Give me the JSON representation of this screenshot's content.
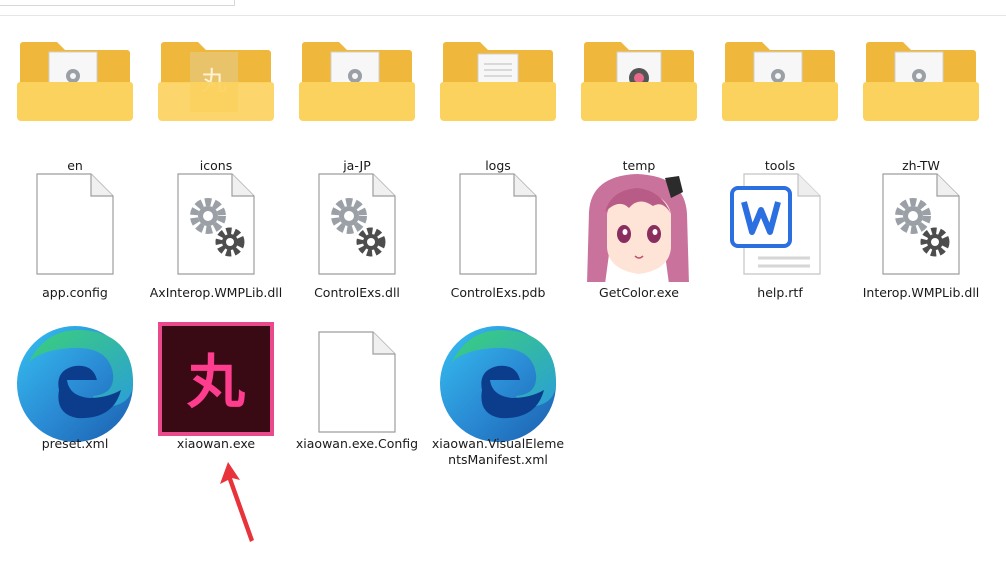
{
  "items": [
    {
      "name": "en",
      "type": "folder",
      "icon": "folder-config-icon"
    },
    {
      "name": "icons",
      "type": "folder",
      "icon": "folder-icons-icon"
    },
    {
      "name": "ja-JP",
      "type": "folder",
      "icon": "folder-config-icon"
    },
    {
      "name": "logs",
      "type": "folder",
      "icon": "folder-document-icon"
    },
    {
      "name": "temp",
      "type": "folder",
      "icon": "folder-media-icon"
    },
    {
      "name": "tools",
      "type": "folder",
      "icon": "folder-config-icon"
    },
    {
      "name": "zh-TW",
      "type": "folder",
      "icon": "folder-config-icon"
    },
    {
      "name": "app.config",
      "type": "file",
      "icon": "blank-file-icon"
    },
    {
      "name": "AxInterop.WMPLib.dll",
      "type": "file",
      "icon": "dll-gears-icon"
    },
    {
      "name": "ControlExs.dll",
      "type": "file",
      "icon": "dll-gears-icon"
    },
    {
      "name": "ControlExs.pdb",
      "type": "file",
      "icon": "blank-file-icon"
    },
    {
      "name": "GetColor.exe",
      "type": "file",
      "icon": "anime-girl-app-icon"
    },
    {
      "name": "help.rtf",
      "type": "file",
      "icon": "wps-writer-icon"
    },
    {
      "name": "Interop.WMPLib.dll",
      "type": "file",
      "icon": "dll-gears-icon"
    },
    {
      "name": "preset.xml",
      "type": "file",
      "icon": "edge-browser-icon"
    },
    {
      "name": "xiaowan.exe",
      "type": "file",
      "icon": "xiaowan-app-icon",
      "selected": true,
      "glyph": "丸"
    },
    {
      "name": "xiaowan.exe.Config",
      "type": "file",
      "icon": "blank-file-icon"
    },
    {
      "name": "xiaowan.VisualElementsManifest.xml",
      "type": "file",
      "icon": "edge-browser-icon"
    }
  ],
  "colors": {
    "folder_back": "#f0b73d",
    "folder_front": "#fcd25f",
    "selection_border": "#e94a8b",
    "xiaowan_bg": "#3a0a14",
    "xiaowan_glyph": "#ff3d8e",
    "annotation_arrow": "#e8333a"
  }
}
